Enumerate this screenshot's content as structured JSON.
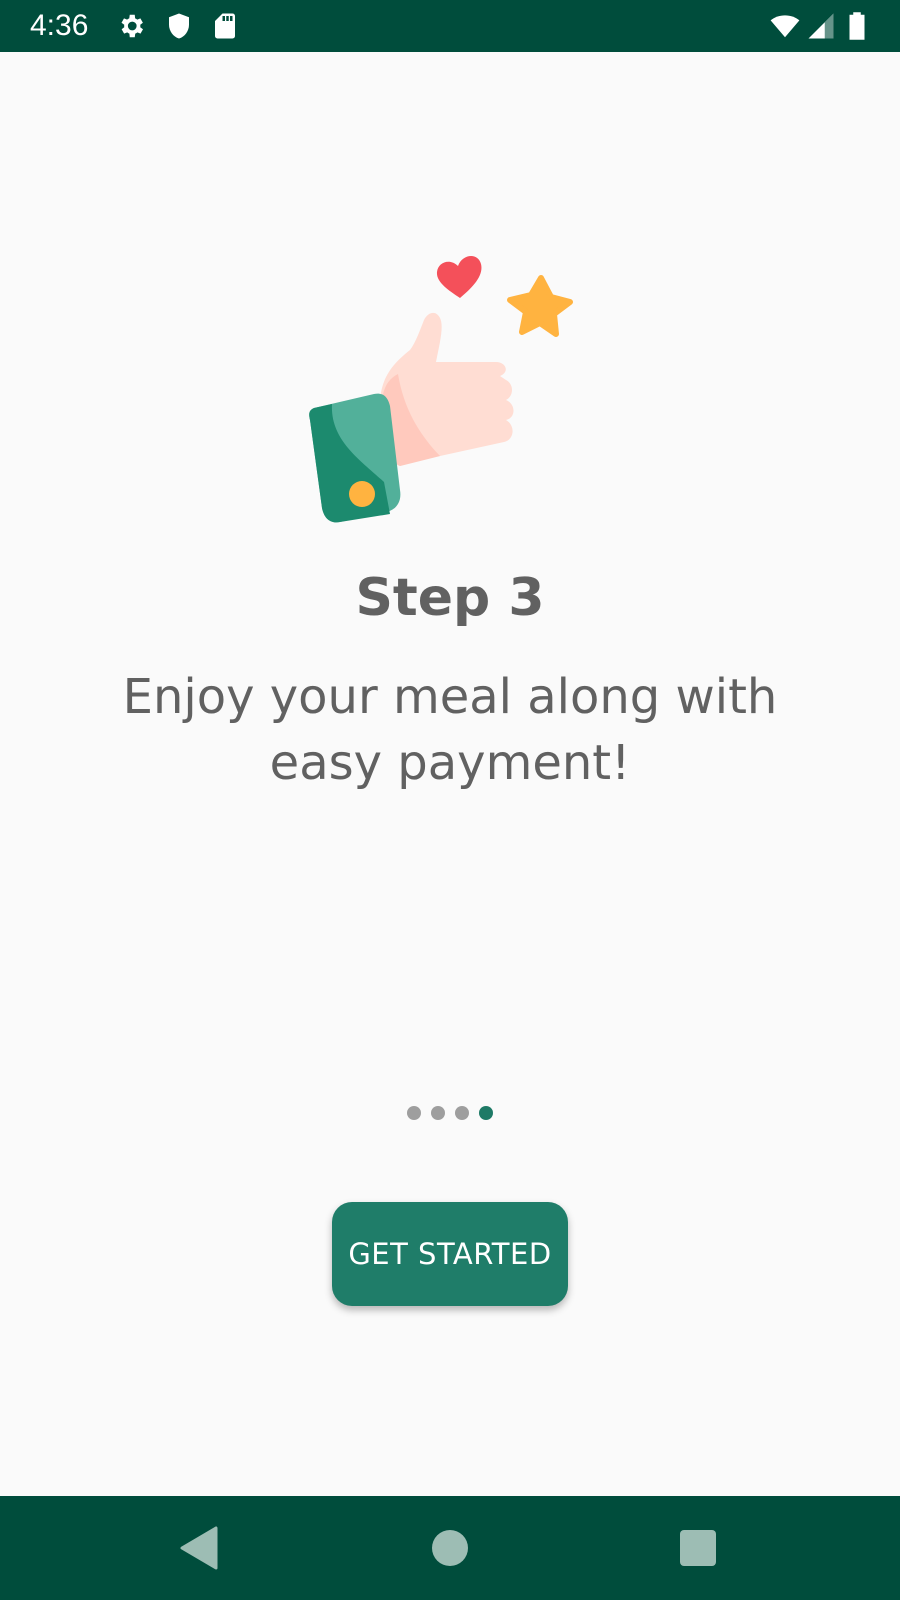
{
  "status_bar": {
    "time": "4:36",
    "left_icons": [
      "gear-icon",
      "shield-icon",
      "sd-card-icon"
    ],
    "right_icons": [
      "wifi-icon",
      "cell-signal-icon",
      "battery-icon"
    ]
  },
  "onboarding": {
    "illustration": "thumbs-up-with-heart-and-star",
    "title": "Step 3",
    "subtitle": "Enjoy your meal along with easy payment!",
    "page_indicator": {
      "total": 4,
      "active": 4
    },
    "cta_label": "GET STARTED"
  },
  "nav_bar": {
    "buttons": [
      "back-icon",
      "home-icon",
      "recents-icon"
    ]
  },
  "colors": {
    "status_bar": "#004d3c",
    "primary": "#1f7d69",
    "text": "#616161",
    "dot_inactive": "#9e9e9e",
    "background": "#fafafa"
  }
}
